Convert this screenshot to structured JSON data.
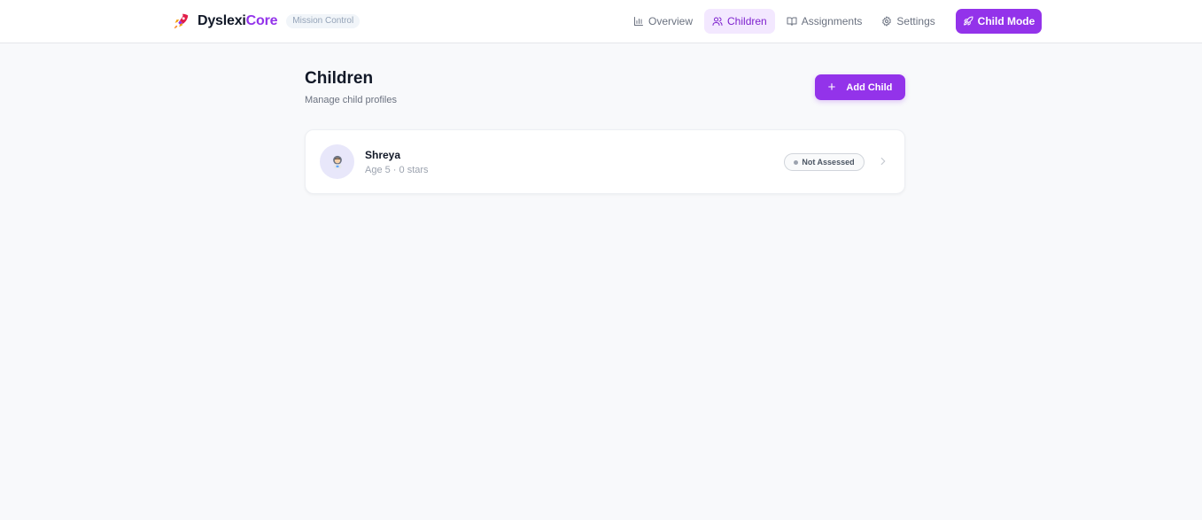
{
  "brand": {
    "name_prefix": "Dyslexi",
    "name_accent": "Core",
    "badge": "Mission Control",
    "accent_color": "#9333ea"
  },
  "nav": {
    "items": [
      {
        "label": "Overview",
        "icon": "bar-chart-icon",
        "active": false
      },
      {
        "label": "Children",
        "icon": "users-icon",
        "active": true
      },
      {
        "label": "Assignments",
        "icon": "book-open-icon",
        "active": false
      },
      {
        "label": "Settings",
        "icon": "gear-icon",
        "active": false
      }
    ],
    "child_mode_label": "Child Mode"
  },
  "page": {
    "title": "Children",
    "subtitle": "Manage child profiles",
    "add_button_label": "Add Child"
  },
  "children": [
    {
      "name": "Shreya",
      "meta": "Age 5 · 0 stars",
      "status": "Not Assessed",
      "avatar_icon": "astronaut-icon"
    }
  ]
}
